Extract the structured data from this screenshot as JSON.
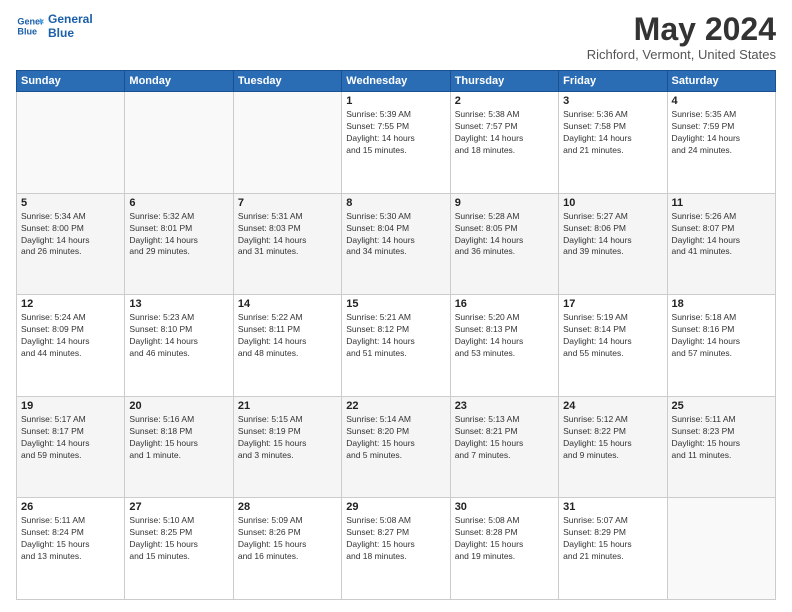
{
  "logo": {
    "line1": "General",
    "line2": "Blue"
  },
  "title": "May 2024",
  "location": "Richford, Vermont, United States",
  "days_header": [
    "Sunday",
    "Monday",
    "Tuesday",
    "Wednesday",
    "Thursday",
    "Friday",
    "Saturday"
  ],
  "weeks": [
    [
      {
        "day": "",
        "info": ""
      },
      {
        "day": "",
        "info": ""
      },
      {
        "day": "",
        "info": ""
      },
      {
        "day": "1",
        "info": "Sunrise: 5:39 AM\nSunset: 7:55 PM\nDaylight: 14 hours\nand 15 minutes."
      },
      {
        "day": "2",
        "info": "Sunrise: 5:38 AM\nSunset: 7:57 PM\nDaylight: 14 hours\nand 18 minutes."
      },
      {
        "day": "3",
        "info": "Sunrise: 5:36 AM\nSunset: 7:58 PM\nDaylight: 14 hours\nand 21 minutes."
      },
      {
        "day": "4",
        "info": "Sunrise: 5:35 AM\nSunset: 7:59 PM\nDaylight: 14 hours\nand 24 minutes."
      }
    ],
    [
      {
        "day": "5",
        "info": "Sunrise: 5:34 AM\nSunset: 8:00 PM\nDaylight: 14 hours\nand 26 minutes."
      },
      {
        "day": "6",
        "info": "Sunrise: 5:32 AM\nSunset: 8:01 PM\nDaylight: 14 hours\nand 29 minutes."
      },
      {
        "day": "7",
        "info": "Sunrise: 5:31 AM\nSunset: 8:03 PM\nDaylight: 14 hours\nand 31 minutes."
      },
      {
        "day": "8",
        "info": "Sunrise: 5:30 AM\nSunset: 8:04 PM\nDaylight: 14 hours\nand 34 minutes."
      },
      {
        "day": "9",
        "info": "Sunrise: 5:28 AM\nSunset: 8:05 PM\nDaylight: 14 hours\nand 36 minutes."
      },
      {
        "day": "10",
        "info": "Sunrise: 5:27 AM\nSunset: 8:06 PM\nDaylight: 14 hours\nand 39 minutes."
      },
      {
        "day": "11",
        "info": "Sunrise: 5:26 AM\nSunset: 8:07 PM\nDaylight: 14 hours\nand 41 minutes."
      }
    ],
    [
      {
        "day": "12",
        "info": "Sunrise: 5:24 AM\nSunset: 8:09 PM\nDaylight: 14 hours\nand 44 minutes."
      },
      {
        "day": "13",
        "info": "Sunrise: 5:23 AM\nSunset: 8:10 PM\nDaylight: 14 hours\nand 46 minutes."
      },
      {
        "day": "14",
        "info": "Sunrise: 5:22 AM\nSunset: 8:11 PM\nDaylight: 14 hours\nand 48 minutes."
      },
      {
        "day": "15",
        "info": "Sunrise: 5:21 AM\nSunset: 8:12 PM\nDaylight: 14 hours\nand 51 minutes."
      },
      {
        "day": "16",
        "info": "Sunrise: 5:20 AM\nSunset: 8:13 PM\nDaylight: 14 hours\nand 53 minutes."
      },
      {
        "day": "17",
        "info": "Sunrise: 5:19 AM\nSunset: 8:14 PM\nDaylight: 14 hours\nand 55 minutes."
      },
      {
        "day": "18",
        "info": "Sunrise: 5:18 AM\nSunset: 8:16 PM\nDaylight: 14 hours\nand 57 minutes."
      }
    ],
    [
      {
        "day": "19",
        "info": "Sunrise: 5:17 AM\nSunset: 8:17 PM\nDaylight: 14 hours\nand 59 minutes."
      },
      {
        "day": "20",
        "info": "Sunrise: 5:16 AM\nSunset: 8:18 PM\nDaylight: 15 hours\nand 1 minute."
      },
      {
        "day": "21",
        "info": "Sunrise: 5:15 AM\nSunset: 8:19 PM\nDaylight: 15 hours\nand 3 minutes."
      },
      {
        "day": "22",
        "info": "Sunrise: 5:14 AM\nSunset: 8:20 PM\nDaylight: 15 hours\nand 5 minutes."
      },
      {
        "day": "23",
        "info": "Sunrise: 5:13 AM\nSunset: 8:21 PM\nDaylight: 15 hours\nand 7 minutes."
      },
      {
        "day": "24",
        "info": "Sunrise: 5:12 AM\nSunset: 8:22 PM\nDaylight: 15 hours\nand 9 minutes."
      },
      {
        "day": "25",
        "info": "Sunrise: 5:11 AM\nSunset: 8:23 PM\nDaylight: 15 hours\nand 11 minutes."
      }
    ],
    [
      {
        "day": "26",
        "info": "Sunrise: 5:11 AM\nSunset: 8:24 PM\nDaylight: 15 hours\nand 13 minutes."
      },
      {
        "day": "27",
        "info": "Sunrise: 5:10 AM\nSunset: 8:25 PM\nDaylight: 15 hours\nand 15 minutes."
      },
      {
        "day": "28",
        "info": "Sunrise: 5:09 AM\nSunset: 8:26 PM\nDaylight: 15 hours\nand 16 minutes."
      },
      {
        "day": "29",
        "info": "Sunrise: 5:08 AM\nSunset: 8:27 PM\nDaylight: 15 hours\nand 18 minutes."
      },
      {
        "day": "30",
        "info": "Sunrise: 5:08 AM\nSunset: 8:28 PM\nDaylight: 15 hours\nand 19 minutes."
      },
      {
        "day": "31",
        "info": "Sunrise: 5:07 AM\nSunset: 8:29 PM\nDaylight: 15 hours\nand 21 minutes."
      },
      {
        "day": "",
        "info": ""
      }
    ]
  ]
}
